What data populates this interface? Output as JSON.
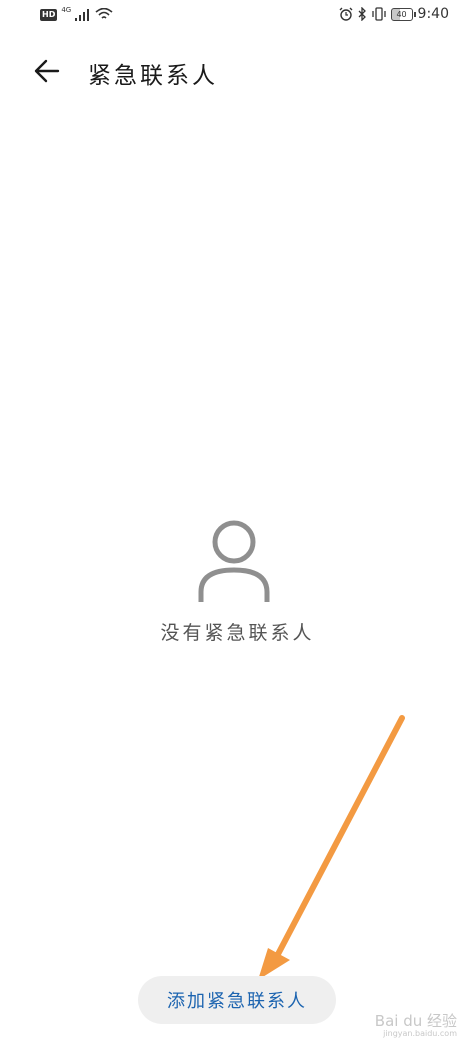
{
  "status_bar": {
    "hd": "HD",
    "network": "4G",
    "battery": "40",
    "time": "9:40",
    "icons": [
      "signal-icon",
      "wifi-icon",
      "alarm-icon",
      "bluetooth-icon",
      "vibrate-icon",
      "battery-icon"
    ]
  },
  "header": {
    "back_icon": "arrow-left-icon",
    "title": "紧急联系人"
  },
  "empty_state": {
    "icon": "person-icon",
    "text": "没有紧急联系人"
  },
  "actions": {
    "add_label": "添加紧急联系人",
    "accent_color": "#1c64b0"
  },
  "annotation": {
    "arrow_color": "#f39a42"
  },
  "watermark": {
    "text": "Bai du 经验",
    "sub": "jingyan.baidu.com"
  }
}
